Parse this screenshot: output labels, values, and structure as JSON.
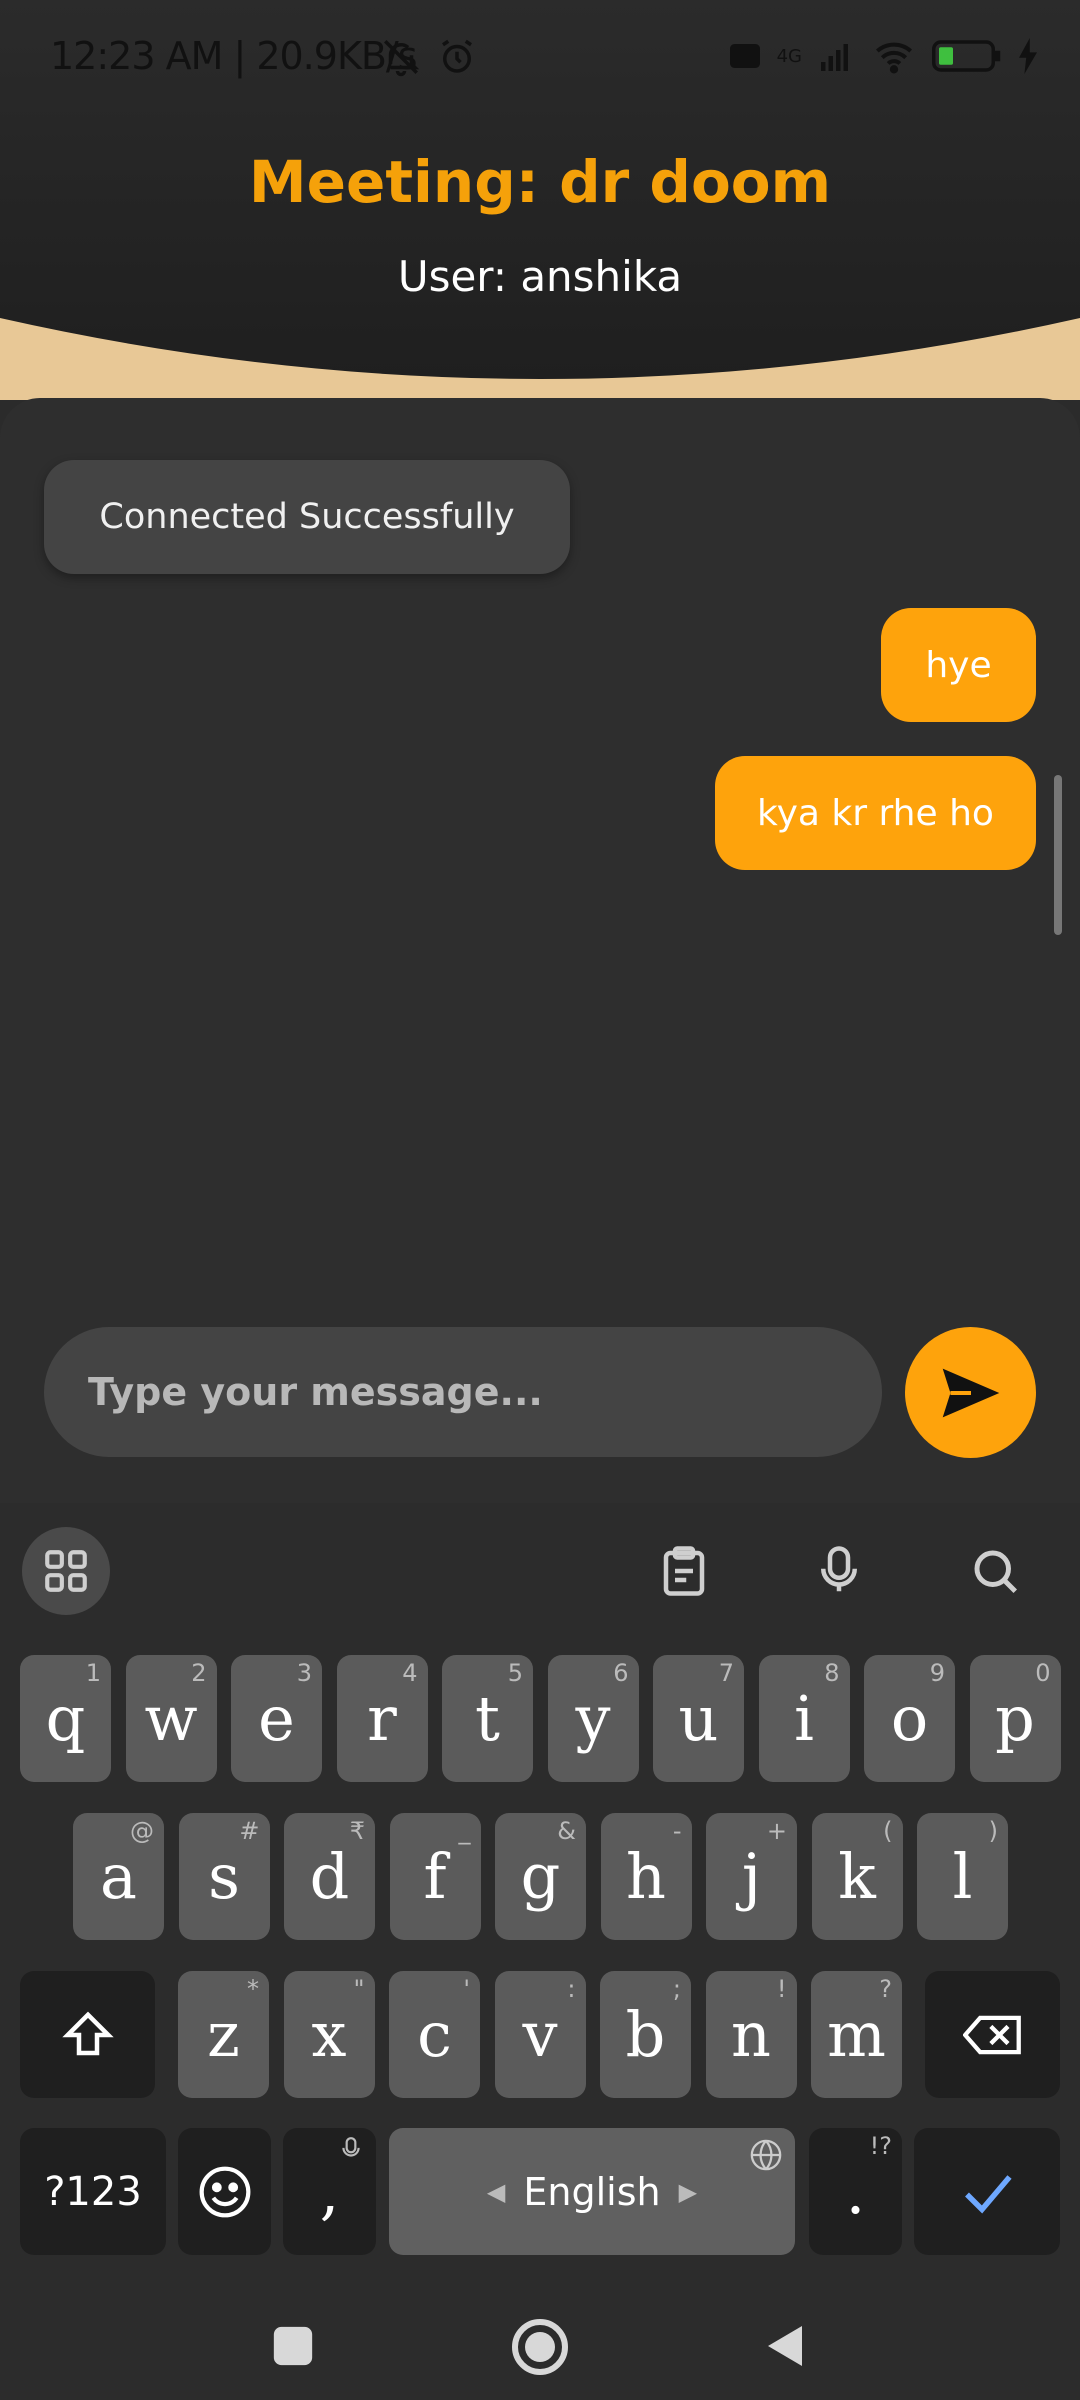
{
  "status_bar": {
    "time_text": "12:23 AM | 20.9KB/s",
    "network": "4G",
    "battery": "21"
  },
  "header": {
    "title": "Meeting: dr doom",
    "subtitle": "User: anshika"
  },
  "chat": {
    "system_message": "Connected Successfully",
    "messages": [
      {
        "text": "hye",
        "sender": "me"
      },
      {
        "text": "kya kr rhe ho",
        "sender": "me"
      }
    ]
  },
  "composer": {
    "placeholder": "Type your message..."
  },
  "keyboard": {
    "row1": [
      {
        "k": "q",
        "h": "1"
      },
      {
        "k": "w",
        "h": "2"
      },
      {
        "k": "e",
        "h": "3"
      },
      {
        "k": "r",
        "h": "4"
      },
      {
        "k": "t",
        "h": "5"
      },
      {
        "k": "y",
        "h": "6"
      },
      {
        "k": "u",
        "h": "7"
      },
      {
        "k": "i",
        "h": "8"
      },
      {
        "k": "o",
        "h": "9"
      },
      {
        "k": "p",
        "h": "0"
      }
    ],
    "row2": [
      {
        "k": "a",
        "h": "@"
      },
      {
        "k": "s",
        "h": "#"
      },
      {
        "k": "d",
        "h": "₹"
      },
      {
        "k": "f",
        "h": "_"
      },
      {
        "k": "g",
        "h": "&"
      },
      {
        "k": "h",
        "h": "-"
      },
      {
        "k": "j",
        "h": "+"
      },
      {
        "k": "k",
        "h": "("
      },
      {
        "k": "l",
        "h": ")"
      }
    ],
    "row3": [
      {
        "k": "z",
        "h": "*"
      },
      {
        "k": "x",
        "h": "\""
      },
      {
        "k": "c",
        "h": "'"
      },
      {
        "k": "v",
        "h": ":"
      },
      {
        "k": "b",
        "h": ";"
      },
      {
        "k": "n",
        "h": "!"
      },
      {
        "k": "m",
        "h": "?"
      }
    ],
    "symbols_label": "?123",
    "comma": ",",
    "space_label": "English",
    "period": ".",
    "period_hint": "!?"
  },
  "colors": {
    "accent": "#fea30c",
    "title": "#f5a10a",
    "panel": "#2e2e2e",
    "header_top": "#262626",
    "wave": "#e8c896"
  }
}
